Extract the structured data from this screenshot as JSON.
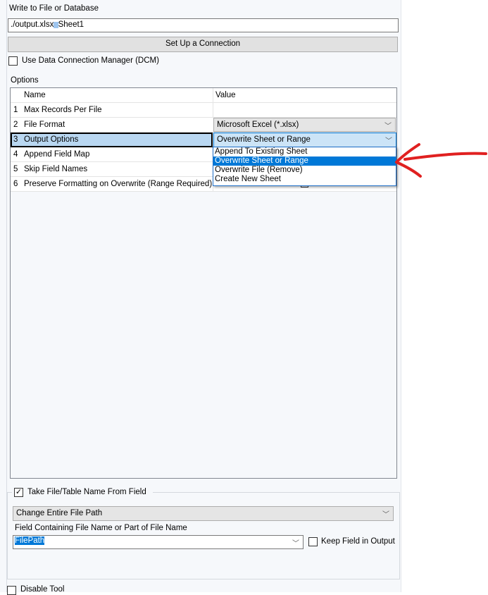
{
  "section_title": "Write to File or Database",
  "file_path": "./output.xlsx",
  "file_sep": "|||",
  "sheet": "Sheet1",
  "connection_button": "Set Up a Connection",
  "dcm_label": "Use Data Connection Manager (DCM)",
  "dcm_checked": false,
  "options_label": "Options",
  "grid": {
    "headers": [
      "Name",
      "Value"
    ],
    "rows": [
      {
        "num": "1",
        "name": "Max Records Per File",
        "value": ""
      },
      {
        "num": "2",
        "name": "File Format",
        "value": "Microsoft Excel (*.xlsx)"
      },
      {
        "num": "3",
        "name": "Output Options",
        "value": "Overwrite Sheet or Range"
      },
      {
        "num": "4",
        "name": "Append Field Map",
        "value": ""
      },
      {
        "num": "5",
        "name": "Skip Field Names",
        "value": ""
      },
      {
        "num": "6",
        "name": "Preserve Formatting on Overwrite (Range Required)",
        "value": ""
      }
    ]
  },
  "dropdown_options": [
    "Append To Existing Sheet",
    "Overwrite Sheet or Range",
    "Overwrite File (Remove)",
    "Create New Sheet"
  ],
  "dropdown_selected": "Overwrite Sheet or Range",
  "annotation_color": "#e02020",
  "take_name": {
    "label": "Take File/Table Name From Field",
    "checked": true,
    "mode": "Change Entire File Path",
    "field_label": "Field Containing File Name or Part of File Name",
    "field": "FilePath",
    "keep_label": "Keep Field in Output",
    "keep_checked": false
  },
  "disable_tool": "Disable Tool"
}
